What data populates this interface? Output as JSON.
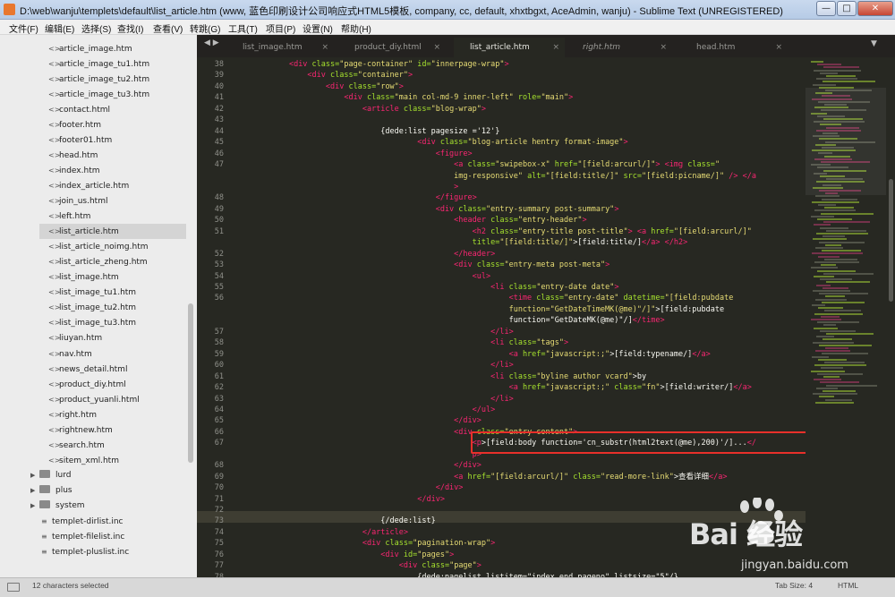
{
  "window": {
    "title": "D:\\web\\wanju\\templets\\default\\list_article.htm (www, 蓝色印刷设计公司响应式HTML5模板, company, cc, default, xhxtbgxt, AceAdmin, wanju) - Sublime Text (UNREGISTERED)",
    "min_glyph": "—",
    "max_glyph": "□",
    "close_glyph": "✕"
  },
  "menu": [
    "文件(F)",
    "编辑(E)",
    "选择(S)",
    "查找(I)",
    "查看(V)",
    "转跳(G)",
    "工具(T)",
    "项目(P)",
    "设置(N)",
    "帮助(H)"
  ],
  "sidebar": {
    "files": [
      "article_image.htm",
      "article_image_tu1.htm",
      "article_image_tu2.htm",
      "article_image_tu3.htm",
      "contact.html",
      "footer.htm",
      "footer01.htm",
      "head.htm",
      "index.htm",
      "index_article.htm",
      "join_us.html",
      "left.htm",
      "list_article.htm",
      "list_article_noimg.htm",
      "list_article_zheng.htm",
      "list_image.htm",
      "list_image_tu1.htm",
      "list_image_tu2.htm",
      "list_image_tu3.htm",
      "liuyan.htm",
      "nav.htm",
      "news_detail.html",
      "product_diy.html",
      "product_yuanli.html",
      "right.htm",
      "rightnew.htm",
      "search.htm",
      "sitem_xml.htm"
    ],
    "selected_file": "list_article.htm",
    "folders": [
      "lurd",
      "plus",
      "system"
    ],
    "incs": [
      "templet-dirlist.inc",
      "templet-filelist.inc",
      "templet-pluslist.inc"
    ]
  },
  "tabs": [
    {
      "label": "list_image.htm"
    },
    {
      "label": "product_diy.html"
    },
    {
      "label": "list_article.htm"
    },
    {
      "label": "right.htm"
    },
    {
      "label": "head.htm"
    }
  ],
  "editor": {
    "line_numbers": [
      "38",
      "39",
      "40",
      "41",
      "42",
      "43",
      "44",
      "45",
      "46",
      "47",
      "",
      "",
      "48",
      "49",
      "50",
      "51",
      "",
      "52",
      "53",
      "54",
      "55",
      "56",
      "",
      "",
      "57",
      "58",
      "59",
      "60",
      "61",
      "62",
      "63",
      "64",
      "65",
      "66",
      "67",
      "",
      "68",
      "69",
      "70",
      "71",
      "72",
      "73",
      "74",
      "75",
      "76",
      "77",
      "78"
    ],
    "code": [
      [
        [
          "        ",
          ""
        ],
        [
          "<div ",
          "t"
        ],
        [
          "class=",
          "a"
        ],
        [
          "\"page-container\" ",
          "s"
        ],
        [
          "id=",
          "a"
        ],
        [
          "\"innerpage-wrap\"",
          "s"
        ],
        [
          ">",
          "t"
        ]
      ],
      [
        [
          "            ",
          ""
        ],
        [
          "<div ",
          "t"
        ],
        [
          "class=",
          "a"
        ],
        [
          "\"container\"",
          "s"
        ],
        [
          ">",
          "t"
        ]
      ],
      [
        [
          "                ",
          ""
        ],
        [
          "<div ",
          "t"
        ],
        [
          "class=",
          "a"
        ],
        [
          "\"row\"",
          "s"
        ],
        [
          ">",
          "t"
        ]
      ],
      [
        [
          "                    ",
          ""
        ],
        [
          "<div ",
          "t"
        ],
        [
          "class=",
          "a"
        ],
        [
          "\"main col-md-9 inner-left\" ",
          "s"
        ],
        [
          "role=",
          "a"
        ],
        [
          "\"main\"",
          "s"
        ],
        [
          ">",
          "t"
        ]
      ],
      [
        [
          "                        ",
          ""
        ],
        [
          "<article ",
          "t"
        ],
        [
          "class=",
          "a"
        ],
        [
          "\"blog-wrap\"",
          "s"
        ],
        [
          ">",
          "t"
        ]
      ],
      [
        [
          "",
          ""
        ]
      ],
      [
        [
          "                            {dede:list pagesize ='12'}",
          ""
        ]
      ],
      [
        [
          "                                    ",
          ""
        ],
        [
          "<div ",
          "t"
        ],
        [
          "class=",
          "a"
        ],
        [
          "\"blog-article hentry format-image\"",
          "s"
        ],
        [
          ">",
          "t"
        ]
      ],
      [
        [
          "                                        ",
          ""
        ],
        [
          "<figure",
          "t"
        ],
        [
          ">",
          "t"
        ]
      ],
      [
        [
          "                                            ",
          ""
        ],
        [
          "<a ",
          "t"
        ],
        [
          "class=",
          "a"
        ],
        [
          "\"swipebox-x\" ",
          "s"
        ],
        [
          "href=",
          "a"
        ],
        [
          "\"[field:arcurl/]\"",
          "s"
        ],
        [
          "> ",
          "t"
        ],
        [
          "<img ",
          "t"
        ],
        [
          "class=",
          "a"
        ],
        [
          "\"",
          "s"
        ]
      ],
      [
        [
          "                                            ",
          ""
        ],
        [
          "img-responsive\" ",
          "s"
        ],
        [
          "alt=",
          "a"
        ],
        [
          "\"[field:title/]\" ",
          "s"
        ],
        [
          "src=",
          "a"
        ],
        [
          "\"[field:picname/]\" ",
          "s"
        ],
        [
          "/> ",
          "t"
        ],
        [
          "</a",
          "t"
        ]
      ],
      [
        [
          "                                            ",
          ""
        ],
        [
          ">",
          "t"
        ]
      ],
      [
        [
          "                                        ",
          ""
        ],
        [
          "</figure>",
          "t"
        ]
      ],
      [
        [
          "                                        ",
          ""
        ],
        [
          "<div ",
          "t"
        ],
        [
          "class=",
          "a"
        ],
        [
          "\"entry-summary post-summary\"",
          "s"
        ],
        [
          ">",
          "t"
        ]
      ],
      [
        [
          "                                            ",
          ""
        ],
        [
          "<header ",
          "t"
        ],
        [
          "class=",
          "a"
        ],
        [
          "\"entry-header\"",
          "s"
        ],
        [
          ">",
          "t"
        ]
      ],
      [
        [
          "                                                ",
          ""
        ],
        [
          "<h2 ",
          "t"
        ],
        [
          "class=",
          "a"
        ],
        [
          "\"entry-title post-title\"",
          "s"
        ],
        [
          "> ",
          "t"
        ],
        [
          "<a ",
          "t"
        ],
        [
          "href=",
          "a"
        ],
        [
          "\"[field:arcurl/]\"",
          "s"
        ]
      ],
      [
        [
          "                                                ",
          ""
        ],
        [
          "title=",
          "a"
        ],
        [
          "\"[field:title/]\"",
          "s"
        ],
        [
          ">[field:title/]",
          ""
        ],
        [
          "</a>",
          "t"
        ],
        [
          " ",
          ""
        ],
        [
          "</h2>",
          "t"
        ]
      ],
      [
        [
          "                                            ",
          ""
        ],
        [
          "</header>",
          "t"
        ]
      ],
      [
        [
          "                                            ",
          ""
        ],
        [
          "<div ",
          "t"
        ],
        [
          "class=",
          "a"
        ],
        [
          "\"entry-meta post-meta\"",
          "s"
        ],
        [
          ">",
          "t"
        ]
      ],
      [
        [
          "                                                ",
          ""
        ],
        [
          "<ul",
          "t"
        ],
        [
          ">",
          "t"
        ]
      ],
      [
        [
          "                                                    ",
          ""
        ],
        [
          "<li ",
          "t"
        ],
        [
          "class=",
          "a"
        ],
        [
          "\"entry-date date\"",
          "s"
        ],
        [
          ">",
          "t"
        ]
      ],
      [
        [
          "                                                        ",
          ""
        ],
        [
          "<time ",
          "t"
        ],
        [
          "class=",
          "a"
        ],
        [
          "\"entry-date\" ",
          "s"
        ],
        [
          "datetime=",
          "a"
        ],
        [
          "\"[field:pubdate",
          "s"
        ]
      ],
      [
        [
          "                                                        ",
          ""
        ],
        [
          "function=\"GetDateTimeMK(@me)\"/]\"",
          "s"
        ],
        [
          ">[field:pubdate",
          ""
        ]
      ],
      [
        [
          "                                                        function=\"GetDateMK(@me)\"/]",
          ""
        ],
        [
          "</time>",
          "t"
        ]
      ],
      [
        [
          "                                                    ",
          ""
        ],
        [
          "</li>",
          "t"
        ]
      ],
      [
        [
          "                                                    ",
          ""
        ],
        [
          "<li ",
          "t"
        ],
        [
          "class=",
          "a"
        ],
        [
          "\"tags\"",
          "s"
        ],
        [
          ">",
          "t"
        ]
      ],
      [
        [
          "                                                        ",
          ""
        ],
        [
          "<a ",
          "t"
        ],
        [
          "href=",
          "a"
        ],
        [
          "\"javascript:;\"",
          "s"
        ],
        [
          ">[field:typename/]",
          ""
        ],
        [
          "</a>",
          "t"
        ]
      ],
      [
        [
          "                                                    ",
          ""
        ],
        [
          "</li>",
          "t"
        ]
      ],
      [
        [
          "                                                    ",
          ""
        ],
        [
          "<li ",
          "t"
        ],
        [
          "class=",
          "a"
        ],
        [
          "\"byline author vcard\"",
          "s"
        ],
        [
          ">by",
          ""
        ]
      ],
      [
        [
          "                                                        ",
          ""
        ],
        [
          "<a ",
          "t"
        ],
        [
          "href=",
          "a"
        ],
        [
          "\"javascript:;\" ",
          "s"
        ],
        [
          "class=",
          "a"
        ],
        [
          "\"fn\"",
          "s"
        ],
        [
          ">[field:writer/]",
          ""
        ],
        [
          "</a>",
          "t"
        ]
      ],
      [
        [
          "                                                    ",
          ""
        ],
        [
          "</li>",
          "t"
        ]
      ],
      [
        [
          "                                                ",
          ""
        ],
        [
          "</ul>",
          "t"
        ]
      ],
      [
        [
          "                                            ",
          ""
        ],
        [
          "</div>",
          "t"
        ]
      ],
      [
        [
          "                                            ",
          ""
        ],
        [
          "<div ",
          "t"
        ],
        [
          "class=",
          "a"
        ],
        [
          "\"entry-content\"",
          "s"
        ],
        [
          ">",
          "t"
        ]
      ],
      [
        [
          "                                                ",
          ""
        ],
        [
          "<p",
          "t"
        ],
        [
          ">[field:body function='cn_substr(html2text(@me),200)'/]...",
          ""
        ],
        [
          "</",
          "t"
        ]
      ],
      [
        [
          "                                                ",
          ""
        ],
        [
          "p>",
          "t"
        ]
      ],
      [
        [
          "                                            ",
          ""
        ],
        [
          "</div>",
          "t"
        ]
      ],
      [
        [
          "                                            ",
          ""
        ],
        [
          "<a ",
          "t"
        ],
        [
          "href=",
          "a"
        ],
        [
          "\"[field:arcurl/]\" ",
          "s"
        ],
        [
          "class=",
          "a"
        ],
        [
          "\"read-more-link\"",
          "s"
        ],
        [
          ">查看详细",
          ""
        ],
        [
          "</a>",
          "t"
        ]
      ],
      [
        [
          "                                        ",
          ""
        ],
        [
          "</div>",
          "t"
        ]
      ],
      [
        [
          "                                    ",
          ""
        ],
        [
          "</div>",
          "t"
        ]
      ],
      [
        [
          "",
          ""
        ]
      ],
      [
        [
          "                            {/dede:list}",
          ""
        ]
      ],
      [
        [
          "                        ",
          ""
        ],
        [
          "</article>",
          "t"
        ]
      ],
      [
        [
          "                        ",
          ""
        ],
        [
          "<div ",
          "t"
        ],
        [
          "class=",
          "a"
        ],
        [
          "\"pagination-wrap\"",
          "s"
        ],
        [
          ">",
          "t"
        ]
      ],
      [
        [
          "                            ",
          ""
        ],
        [
          "<div ",
          "t"
        ],
        [
          "id=",
          "a"
        ],
        [
          "\"pages\"",
          "s"
        ],
        [
          ">",
          "t"
        ]
      ],
      [
        [
          "                                ",
          ""
        ],
        [
          "<div ",
          "t"
        ],
        [
          "class=",
          "a"
        ],
        [
          "\"page\"",
          "s"
        ],
        [
          ">",
          "t"
        ]
      ],
      [
        [
          "                                    {dede:pagelist listitem=\"index,end,pageno\" listsize=\"5\"/}",
          ""
        ]
      ]
    ]
  },
  "status": {
    "selection": "12 characters selected",
    "tab_size": "Tab Size: 4",
    "syntax": "HTML"
  },
  "watermark": {
    "brand": "Bai 经验",
    "url": "jingyan.baidu.com"
  },
  "colors": {
    "tag": "#f92672",
    "attribute": "#a6e22e",
    "string": "#e6db74",
    "text": "#f8f8f2",
    "editor_bg": "#272822",
    "highlight_box": "#e8302a"
  }
}
